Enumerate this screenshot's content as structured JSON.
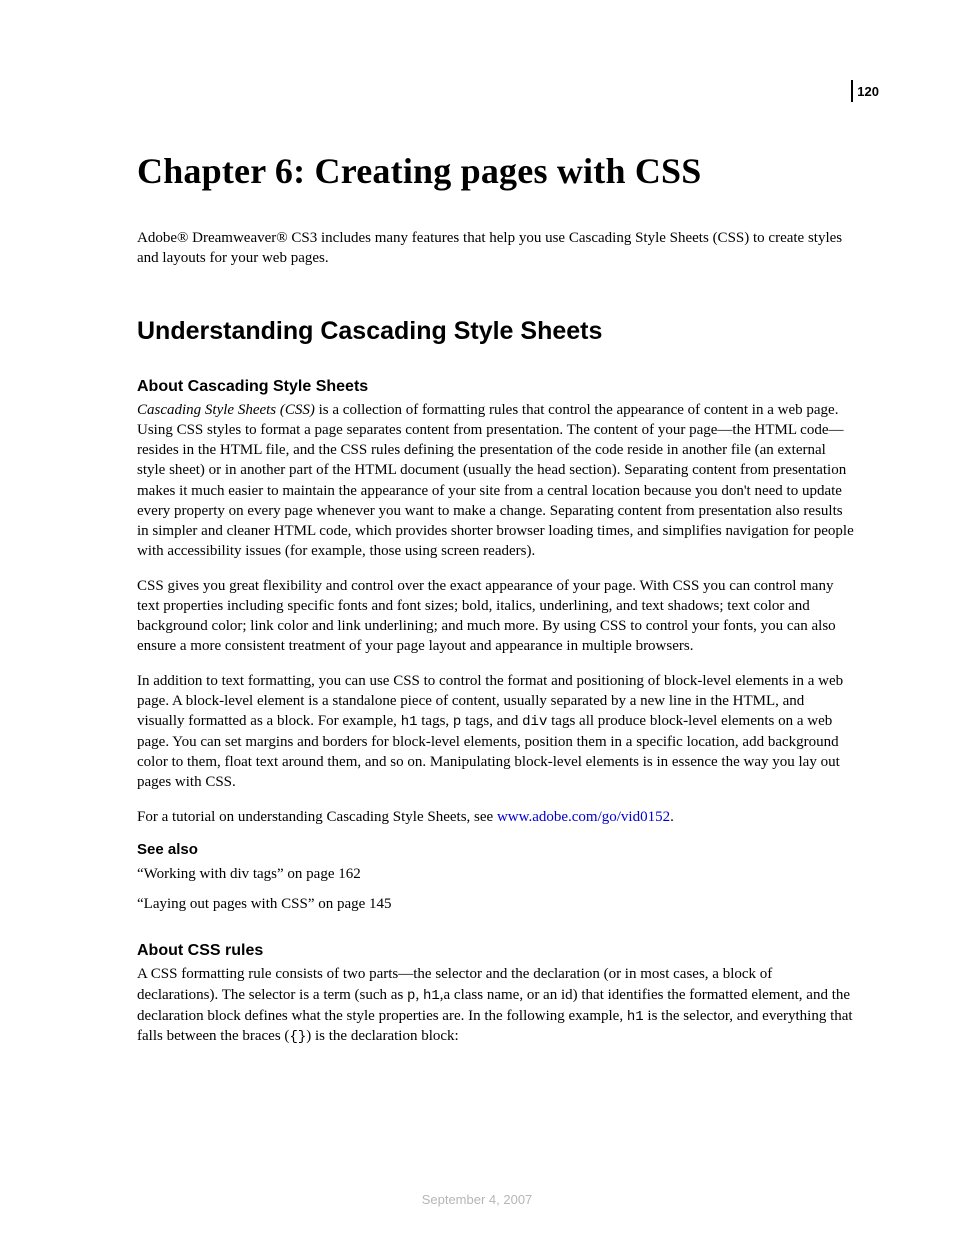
{
  "page_number": "120",
  "chapter_title": "Chapter 6: Creating pages with CSS",
  "intro": "Adobe® Dreamweaver® CS3 includes many features that help you use Cascading Style Sheets (CSS) to create styles and layouts for your web pages.",
  "section_title": "Understanding Cascading Style Sheets",
  "sub1_title": "About Cascading Style Sheets",
  "sub1_p1_lead_italic": "Cascading Style Sheets (CSS)",
  "sub1_p1_rest": " is a collection of formatting rules that control the appearance of content in a web page. Using CSS styles to format a page separates content from presentation. The content of your page—the HTML code—resides in the HTML file, and the CSS rules defining the presentation of the code reside in another file (an external style sheet) or in another part of the HTML document (usually the head section). Separating content from presentation makes it much easier to maintain the appearance of your site from a central location because you don't need to update every property on every page whenever you want to make a change. Separating content from presentation also results in simpler and cleaner HTML code, which provides shorter browser loading times, and simplifies navigation for people with accessibility issues (for example, those using screen readers).",
  "sub1_p2": "CSS gives you great flexibility and control over the exact appearance of your page. With CSS you can control many text properties including specific fonts and font sizes; bold, italics, underlining, and text shadows; text color and background color; link color and link underlining; and much more. By using CSS to control your fonts, you can also ensure a more consistent treatment of your page layout and appearance in multiple browsers.",
  "sub1_p3_a": "In addition to text formatting, you can use CSS to control the format and positioning of block-level elements in a web page. A block-level element is a standalone piece of content, usually separated by a new line in the HTML, and visually formatted as a block. For example, ",
  "sub1_p3_code1": "h1",
  "sub1_p3_b": " tags, ",
  "sub1_p3_code2": "p",
  "sub1_p3_c": " tags, and ",
  "sub1_p3_code3": "div",
  "sub1_p3_d": " tags all produce block-level elements on a web page. You can set margins and borders for block-level elements, position them in a specific location, add background color to them, float text around them, and so on. Manipulating block-level elements is in essence the way you lay out pages with CSS.",
  "sub1_p4_a": "For a tutorial on understanding Cascading Style Sheets, see ",
  "sub1_p4_link": "www.adobe.com/go/vid0152",
  "sub1_p4_b": ".",
  "see_also_title": "See also",
  "see_also_1": "“Working with div tags” on page 162",
  "see_also_2": "“Laying out pages with CSS” on page 145",
  "sub2_title": "About CSS rules",
  "sub2_p1_a": "A CSS formatting rule consists of two parts—the selector and the declaration (or in most cases, a block of declarations). The selector is a term (such as ",
  "sub2_p1_code1": "p",
  "sub2_p1_b": ", ",
  "sub2_p1_code2": "h1",
  "sub2_p1_c": ",a class name, or an id) that identifies the formatted element, and the declaration block defines what the style properties are. In the following example, ",
  "sub2_p1_code3": "h1",
  "sub2_p1_d": " is the selector, and everything that falls between the braces (",
  "sub2_p1_code4": "{}",
  "sub2_p1_e": ") is the declaration block:",
  "footer_date": "September 4, 2007"
}
